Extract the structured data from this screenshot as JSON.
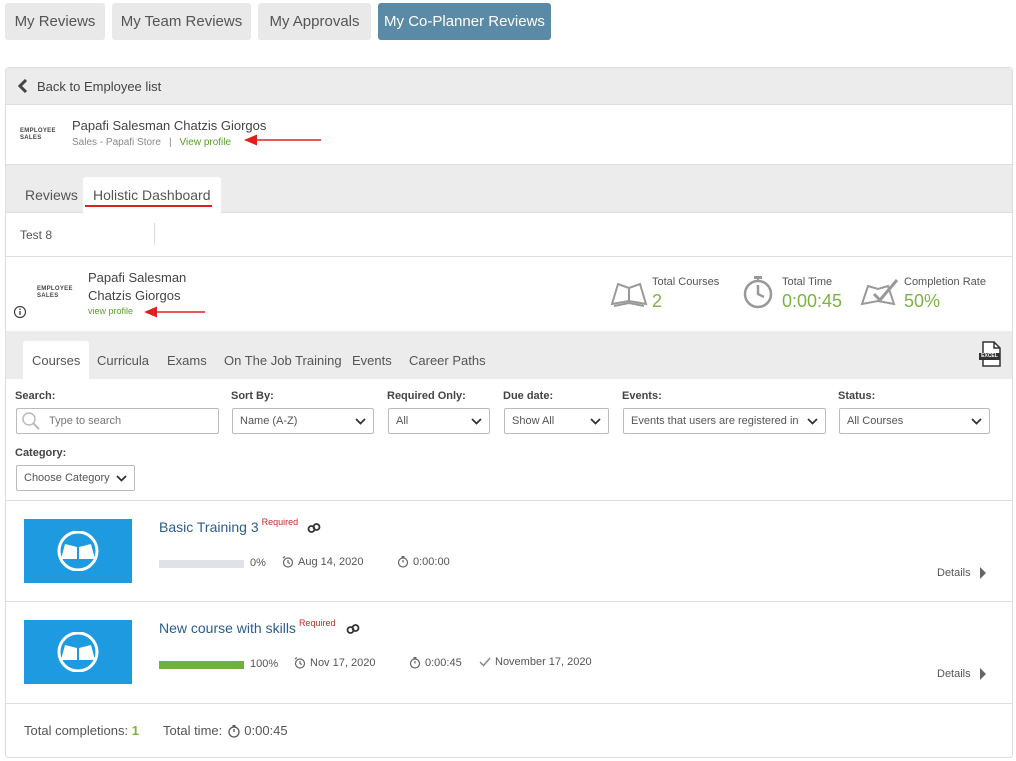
{
  "top_tabs": [
    {
      "label": "My Reviews"
    },
    {
      "label": "My Team Reviews"
    },
    {
      "label": "My Approvals"
    },
    {
      "label": "My Co-Planner Reviews"
    }
  ],
  "back_label": "Back to Employee list",
  "employee": {
    "logo_line1": "EMPLOYEE",
    "logo_line2": "SALES",
    "name": "Papafi Salesman Chatzis Giorgos",
    "first_line": "Papafi Salesman",
    "second_line": "Chatzis Giorgos",
    "department": "Sales - Papafi Store",
    "separator": "|",
    "view_profile": "View profile",
    "view_profile_lower": "view profile"
  },
  "sub_tabs": [
    {
      "label": "Reviews"
    },
    {
      "label": "Holistic Dashboard"
    }
  ],
  "review_item": "Test 8",
  "stats": {
    "total_courses_label": "Total Courses",
    "total_courses_value": "2",
    "total_time_label": "Total Time",
    "total_time_value": "0:00:45",
    "completion_label": "Completion Rate",
    "completion_value": "50%"
  },
  "course_tabs": [
    {
      "label": "Courses"
    },
    {
      "label": "Curricula"
    },
    {
      "label": "Exams"
    },
    {
      "label": "On The Job Training"
    },
    {
      "label": "Events"
    },
    {
      "label": "Career Paths"
    }
  ],
  "filters": {
    "search_label": "Search:",
    "search_placeholder": "Type to search",
    "sort_label": "Sort By:",
    "sort_value": "Name (A-Z)",
    "required_label": "Required Only:",
    "required_value": "All",
    "due_label": "Due date:",
    "due_value": "Show All",
    "events_label": "Events:",
    "events_value": "Events that users are registered in",
    "status_label": "Status:",
    "status_value": "All Courses",
    "category_label": "Category:",
    "category_value": "Choose Category"
  },
  "courses": [
    {
      "title": "Basic Training 3",
      "required": "Required",
      "progress": 0,
      "progress_text": "0%",
      "due": "Aug 14, 2020",
      "time": "0:00:00",
      "completed": "",
      "details": "Details"
    },
    {
      "title": "New course with skills",
      "required": "Required",
      "progress": 100,
      "progress_text": "100%",
      "due": "Nov 17, 2020",
      "time": "0:00:45",
      "completed": "November 17, 2020",
      "details": "Details"
    }
  ],
  "footer": {
    "completions_label": "Total completions:",
    "completions_value": "1",
    "time_label": "Total time:",
    "time_value": "0:00:45"
  },
  "colors": {
    "active_tab": "#5b8aa6",
    "green": "#7cb342",
    "link_blue": "#2c5c8a",
    "required_red": "#c62828",
    "thumb_blue": "#1e9ae0",
    "annotation_red": "#e02020"
  },
  "excel_label": "EXCEL"
}
